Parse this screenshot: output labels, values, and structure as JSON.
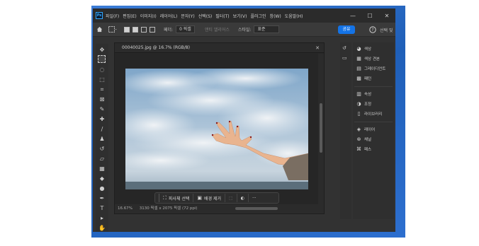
{
  "app": {
    "logo_text": "Ps",
    "menu": [
      "파일(F)",
      "편집(E)",
      "이미지(I)",
      "레이어(L)",
      "문자(Y)",
      "선택(S)",
      "필터(T)",
      "보기(V)",
      "플러그인",
      "창(W)",
      "도움말(H)"
    ],
    "window_controls": {
      "minimize": "—",
      "maximize": "☐",
      "close": "✕"
    }
  },
  "options_bar": {
    "feather_label": "페더:",
    "feather_value": "0 픽셀",
    "antialias_label": "앤티 앨리어스",
    "style_label": "스타일:",
    "style_value": "표준",
    "share_label": "공유",
    "select_label": "선택 및"
  },
  "document": {
    "title": "00040025.jpg @ 16.7% (RGB/8)",
    "close": "✕",
    "zoom": "16.67%",
    "info": "3130 픽셀 x 2075 픽셀 (72 ppi)",
    "context_bar": {
      "select_subject": "피사체 선택",
      "remove_bg": "배경 제거",
      "more": "···"
    }
  },
  "panels": {
    "group1": [
      {
        "icon": "color-icon",
        "label": "색상"
      },
      {
        "icon": "swatches-icon",
        "label": "색상 견본"
      },
      {
        "icon": "gradients-icon",
        "label": "그레이디언트"
      },
      {
        "icon": "patterns-icon",
        "label": "패턴"
      }
    ],
    "group2": [
      {
        "icon": "properties-icon",
        "label": "속성"
      },
      {
        "icon": "adjustments-icon",
        "label": "조정"
      },
      {
        "icon": "libraries-icon",
        "label": "라이브러리"
      }
    ],
    "group3": [
      {
        "icon": "layers-icon",
        "label": "레이어"
      },
      {
        "icon": "channels-icon",
        "label": "채널"
      },
      {
        "icon": "paths-icon",
        "label": "패스"
      }
    ]
  }
}
